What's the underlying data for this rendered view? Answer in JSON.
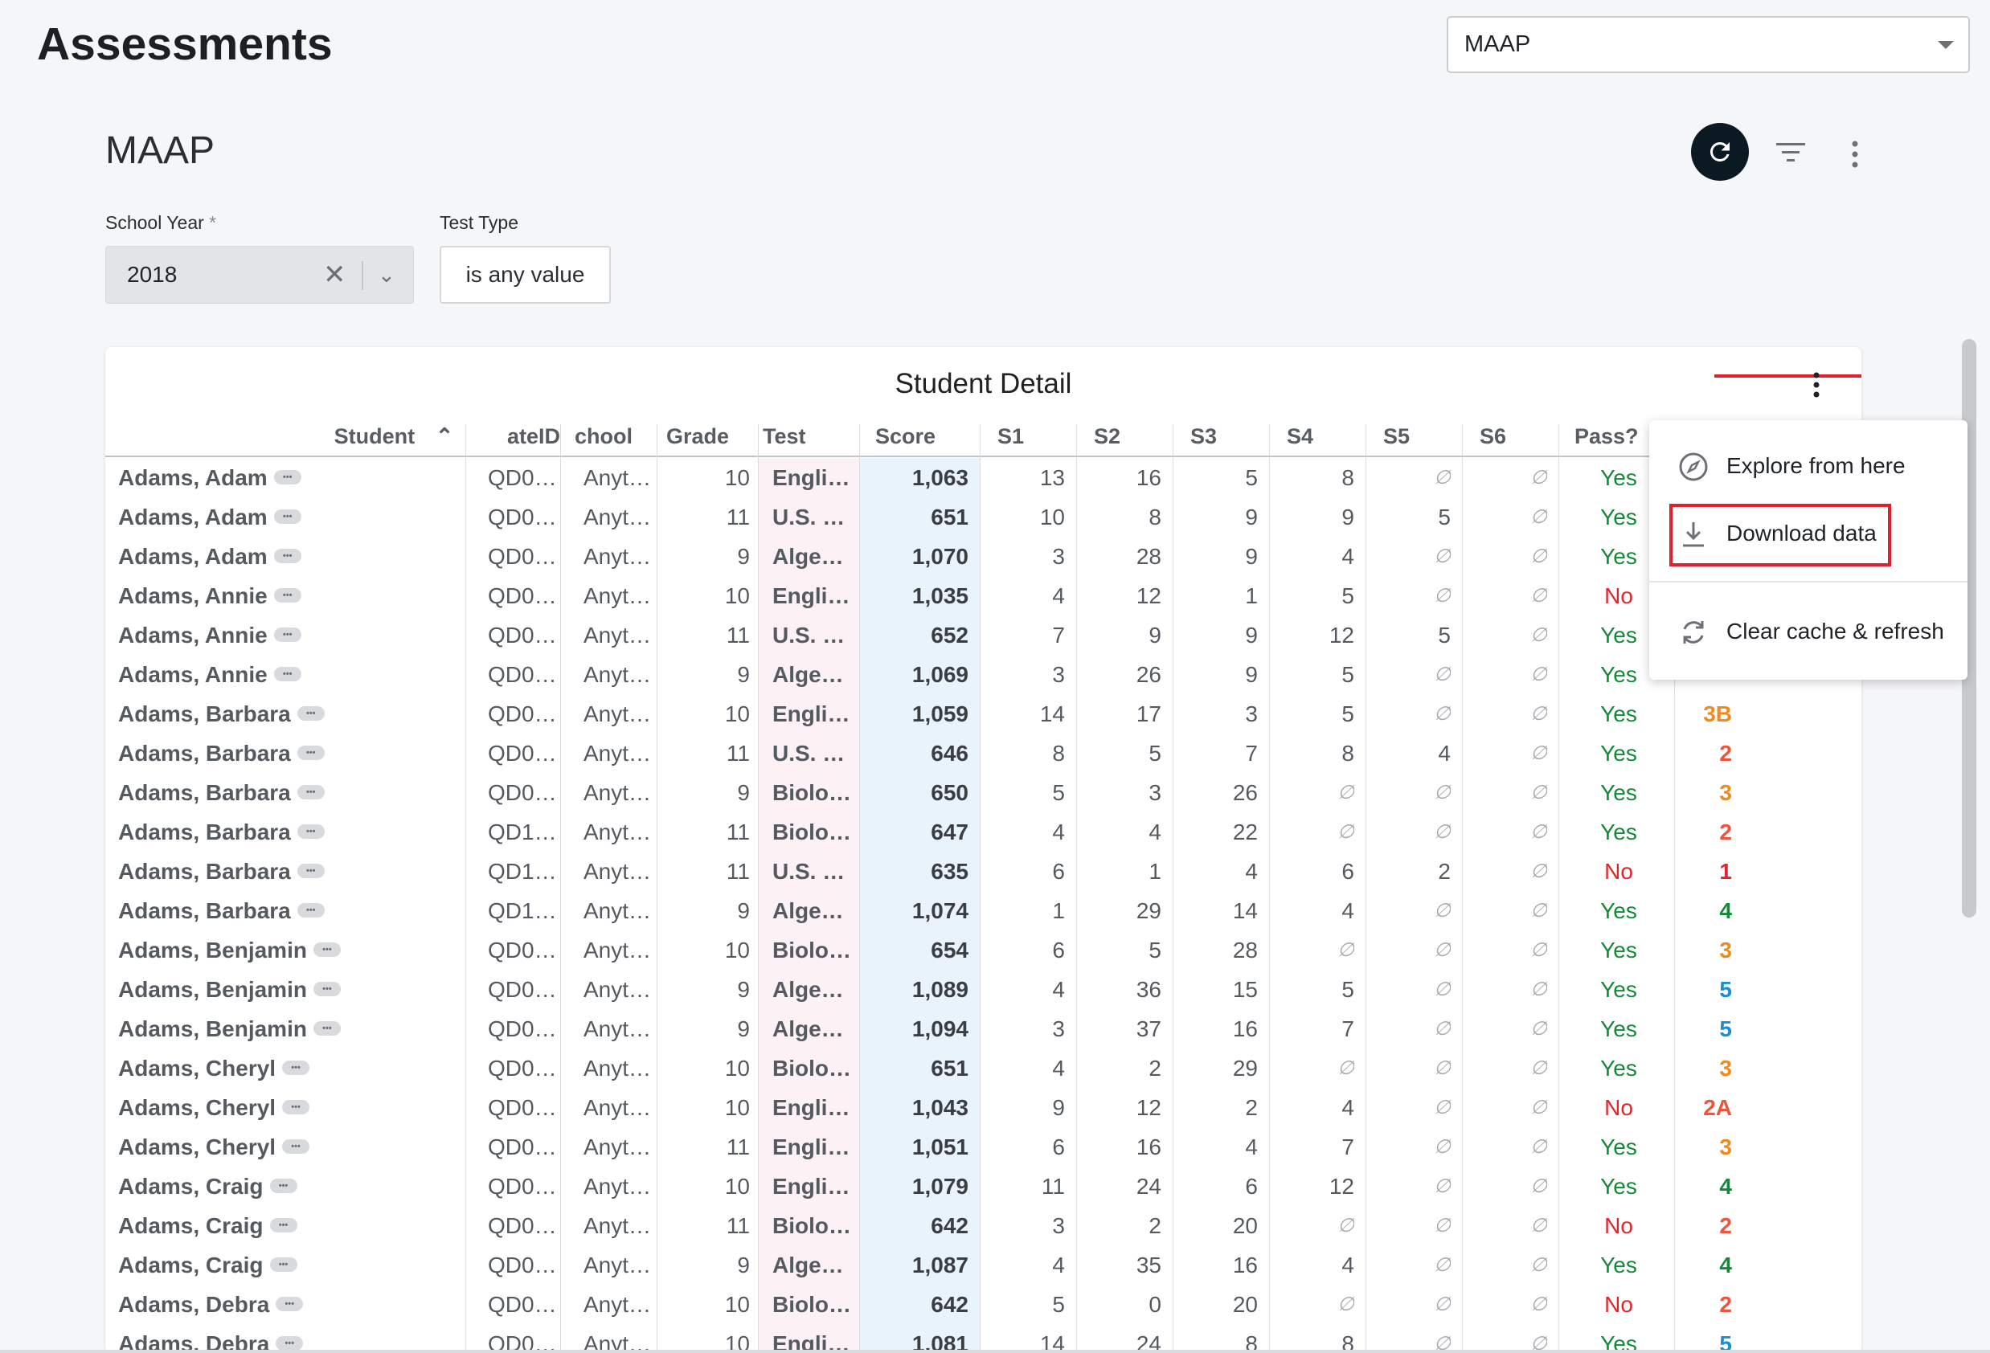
{
  "page": {
    "title": "Assessments"
  },
  "top_select": {
    "value": "MAAP"
  },
  "dashboard": {
    "title": "MAAP"
  },
  "filters": {
    "school_year": {
      "label": "School Year",
      "required_mark": "*",
      "value": "2018"
    },
    "test_type": {
      "label": "Test Type",
      "value": "is any value"
    }
  },
  "tile": {
    "title": "Student Detail",
    "columns": [
      "Student",
      "ateID",
      "chool",
      "Grade",
      "Test",
      "Score",
      "S1",
      "S2",
      "S3",
      "S4",
      "S5",
      "S6",
      "Pass?"
    ],
    "null_symbol": "∅",
    "rows": [
      {
        "student": "Adams, Adam",
        "sid": "QD0…",
        "school": "Anyt…",
        "grade": "10",
        "test": "Engli…",
        "score": "1,063",
        "s1": "13",
        "s2": "16",
        "s3": "5",
        "s4": "8",
        "s5": "∅",
        "s6": "∅",
        "pass": "Yes",
        "level": ""
      },
      {
        "student": "Adams, Adam",
        "sid": "QD0…",
        "school": "Anyt…",
        "grade": "11",
        "test": "U.S. …",
        "score": "651",
        "s1": "10",
        "s2": "8",
        "s3": "9",
        "s4": "9",
        "s5": "5",
        "s6": "∅",
        "pass": "Yes",
        "level": ""
      },
      {
        "student": "Adams, Adam",
        "sid": "QD0…",
        "school": "Anyt…",
        "grade": "9",
        "test": "Alge…",
        "score": "1,070",
        "s1": "3",
        "s2": "28",
        "s3": "9",
        "s4": "4",
        "s5": "∅",
        "s6": "∅",
        "pass": "Yes",
        "level": ""
      },
      {
        "student": "Adams, Annie",
        "sid": "QD0…",
        "school": "Anyt…",
        "grade": "10",
        "test": "Engli…",
        "score": "1,035",
        "s1": "4",
        "s2": "12",
        "s3": "1",
        "s4": "5",
        "s5": "∅",
        "s6": "∅",
        "pass": "No",
        "level": ""
      },
      {
        "student": "Adams, Annie",
        "sid": "QD0…",
        "school": "Anyt…",
        "grade": "11",
        "test": "U.S. …",
        "score": "652",
        "s1": "7",
        "s2": "9",
        "s3": "9",
        "s4": "12",
        "s5": "5",
        "s6": "∅",
        "pass": "Yes",
        "level": ""
      },
      {
        "student": "Adams, Annie",
        "sid": "QD0…",
        "school": "Anyt…",
        "grade": "9",
        "test": "Alge…",
        "score": "1,069",
        "s1": "3",
        "s2": "26",
        "s3": "9",
        "s4": "5",
        "s5": "∅",
        "s6": "∅",
        "pass": "Yes",
        "level": ""
      },
      {
        "student": "Adams, Barbara",
        "sid": "QD0…",
        "school": "Anyt…",
        "grade": "10",
        "test": "Engli…",
        "score": "1,059",
        "s1": "14",
        "s2": "17",
        "s3": "3",
        "s4": "5",
        "s5": "∅",
        "s6": "∅",
        "pass": "Yes",
        "level": "3B"
      },
      {
        "student": "Adams, Barbara",
        "sid": "QD0…",
        "school": "Anyt…",
        "grade": "11",
        "test": "U.S. …",
        "score": "646",
        "s1": "8",
        "s2": "5",
        "s3": "7",
        "s4": "8",
        "s5": "4",
        "s6": "∅",
        "pass": "Yes",
        "level": "2"
      },
      {
        "student": "Adams, Barbara",
        "sid": "QD0…",
        "school": "Anyt…",
        "grade": "9",
        "test": "Biolo…",
        "score": "650",
        "s1": "5",
        "s2": "3",
        "s3": "26",
        "s4": "∅",
        "s5": "∅",
        "s6": "∅",
        "pass": "Yes",
        "level": "3"
      },
      {
        "student": "Adams, Barbara",
        "sid": "QD1…",
        "school": "Anyt…",
        "grade": "11",
        "test": "Biolo…",
        "score": "647",
        "s1": "4",
        "s2": "4",
        "s3": "22",
        "s4": "∅",
        "s5": "∅",
        "s6": "∅",
        "pass": "Yes",
        "level": "2"
      },
      {
        "student": "Adams, Barbara",
        "sid": "QD1…",
        "school": "Anyt…",
        "grade": "11",
        "test": "U.S. …",
        "score": "635",
        "s1": "6",
        "s2": "1",
        "s3": "4",
        "s4": "6",
        "s5": "2",
        "s6": "∅",
        "pass": "No",
        "level": "1"
      },
      {
        "student": "Adams, Barbara",
        "sid": "QD1…",
        "school": "Anyt…",
        "grade": "9",
        "test": "Alge…",
        "score": "1,074",
        "s1": "1",
        "s2": "29",
        "s3": "14",
        "s4": "4",
        "s5": "∅",
        "s6": "∅",
        "pass": "Yes",
        "level": "4"
      },
      {
        "student": "Adams, Benjamin",
        "sid": "QD0…",
        "school": "Anyt…",
        "grade": "10",
        "test": "Biolo…",
        "score": "654",
        "s1": "6",
        "s2": "5",
        "s3": "28",
        "s4": "∅",
        "s5": "∅",
        "s6": "∅",
        "pass": "Yes",
        "level": "3"
      },
      {
        "student": "Adams, Benjamin",
        "sid": "QD0…",
        "school": "Anyt…",
        "grade": "9",
        "test": "Alge…",
        "score": "1,089",
        "s1": "4",
        "s2": "36",
        "s3": "15",
        "s4": "5",
        "s5": "∅",
        "s6": "∅",
        "pass": "Yes",
        "level": "5"
      },
      {
        "student": "Adams, Benjamin",
        "sid": "QD0…",
        "school": "Anyt…",
        "grade": "9",
        "test": "Alge…",
        "score": "1,094",
        "s1": "3",
        "s2": "37",
        "s3": "16",
        "s4": "7",
        "s5": "∅",
        "s6": "∅",
        "pass": "Yes",
        "level": "5"
      },
      {
        "student": "Adams, Cheryl",
        "sid": "QD0…",
        "school": "Anyt…",
        "grade": "10",
        "test": "Biolo…",
        "score": "651",
        "s1": "4",
        "s2": "2",
        "s3": "29",
        "s4": "∅",
        "s5": "∅",
        "s6": "∅",
        "pass": "Yes",
        "level": "3"
      },
      {
        "student": "Adams, Cheryl",
        "sid": "QD0…",
        "school": "Anyt…",
        "grade": "10",
        "test": "Engli…",
        "score": "1,043",
        "s1": "9",
        "s2": "12",
        "s3": "2",
        "s4": "4",
        "s5": "∅",
        "s6": "∅",
        "pass": "No",
        "level": "2A"
      },
      {
        "student": "Adams, Cheryl",
        "sid": "QD0…",
        "school": "Anyt…",
        "grade": "11",
        "test": "Engli…",
        "score": "1,051",
        "s1": "6",
        "s2": "16",
        "s3": "4",
        "s4": "7",
        "s5": "∅",
        "s6": "∅",
        "pass": "Yes",
        "level": "3"
      },
      {
        "student": "Adams, Craig",
        "sid": "QD0…",
        "school": "Anyt…",
        "grade": "10",
        "test": "Engli…",
        "score": "1,079",
        "s1": "11",
        "s2": "24",
        "s3": "6",
        "s4": "12",
        "s5": "∅",
        "s6": "∅",
        "pass": "Yes",
        "level": "4"
      },
      {
        "student": "Adams, Craig",
        "sid": "QD0…",
        "school": "Anyt…",
        "grade": "11",
        "test": "Biolo…",
        "score": "642",
        "s1": "3",
        "s2": "2",
        "s3": "20",
        "s4": "∅",
        "s5": "∅",
        "s6": "∅",
        "pass": "No",
        "level": "2"
      },
      {
        "student": "Adams, Craig",
        "sid": "QD0…",
        "school": "Anyt…",
        "grade": "9",
        "test": "Alge…",
        "score": "1,087",
        "s1": "4",
        "s2": "35",
        "s3": "16",
        "s4": "4",
        "s5": "∅",
        "s6": "∅",
        "pass": "Yes",
        "level": "4"
      },
      {
        "student": "Adams, Debra",
        "sid": "QD0…",
        "school": "Anyt…",
        "grade": "10",
        "test": "Biolo…",
        "score": "642",
        "s1": "5",
        "s2": "0",
        "s3": "20",
        "s4": "∅",
        "s5": "∅",
        "s6": "∅",
        "pass": "No",
        "level": "2"
      },
      {
        "student": "Adams, Debra",
        "sid": "QD0…",
        "school": "Anyt…",
        "grade": "10",
        "test": "Engli…",
        "score": "1,081",
        "s1": "14",
        "s2": "24",
        "s3": "8",
        "s4": "8",
        "s5": "∅",
        "s6": "∅",
        "pass": "Yes",
        "level": "5"
      }
    ]
  },
  "level_colors": {
    "1": "#e3252b",
    "2": "#f0533a",
    "2A": "#f0533a",
    "3": "#f08a1c",
    "3B": "#f08a1c",
    "4": "#138a36",
    "5": "#1a8fd0"
  },
  "context_menu": {
    "items": [
      {
        "label": "Explore from here",
        "icon": "compass-icon"
      },
      {
        "label": "Download data",
        "icon": "download-icon"
      },
      {
        "label": "Clear cache & refresh",
        "icon": "refresh-icon"
      }
    ]
  },
  "colors": {
    "accent": "#0b1a22",
    "highlight": "#e3202a",
    "pass_yes": "#138a36",
    "pass_no": "#e3252b"
  }
}
